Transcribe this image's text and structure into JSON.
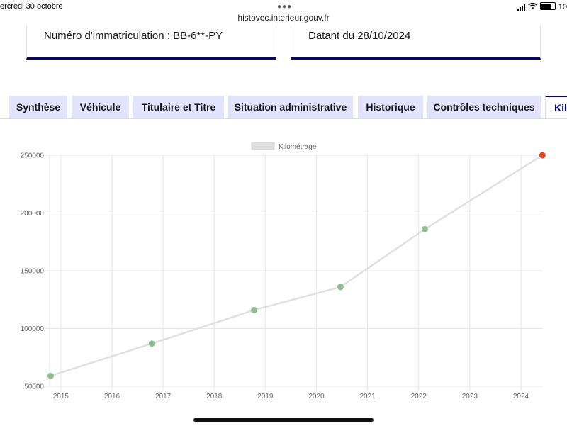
{
  "status_bar": {
    "date": "ercredi 30 octobre",
    "url": "histovec.interieur.gouv.fr",
    "time": "10"
  },
  "cards": {
    "immatriculation": "Numéro d'immatriculation : BB-6**-PY",
    "date": "Datant du 28/10/2024"
  },
  "tabs": [
    {
      "label": "Synthèse"
    },
    {
      "label": "Véhicule"
    },
    {
      "label": "Titulaire et Titre"
    },
    {
      "label": "Situation administrative"
    },
    {
      "label": "Historique"
    },
    {
      "label": "Contrôles techniques"
    },
    {
      "label": "Kil",
      "active": true
    }
  ],
  "colors": {
    "accent": "#000091",
    "tab_bg": "#e3e3fd",
    "point": "#8fbf8f",
    "last_point": "#e8461e",
    "line": "#e0e0e0"
  },
  "chart_data": {
    "type": "line",
    "legend": [
      "Kilométrage"
    ],
    "legend_position": "top",
    "grid": true,
    "ylim": [
      50000,
      250000
    ],
    "y_ticks": [
      "250000",
      "200000",
      "150000",
      "100000",
      "50000"
    ],
    "x_ticks": [
      "2015",
      "2016",
      "2017",
      "2018",
      "2019",
      "2020",
      "2021",
      "2022",
      "2023",
      "2024"
    ],
    "xlim": [
      2014.78,
      2024.43
    ],
    "series": [
      {
        "name": "Kilométrage",
        "points": [
          {
            "x": 2014.8,
            "y": 59000
          },
          {
            "x": 2016.78,
            "y": 87000
          },
          {
            "x": 2018.78,
            "y": 116000
          },
          {
            "x": 2020.47,
            "y": 136000
          },
          {
            "x": 2022.12,
            "y": 186000
          },
          {
            "x": 2024.42,
            "y": 250000
          }
        ]
      }
    ]
  }
}
